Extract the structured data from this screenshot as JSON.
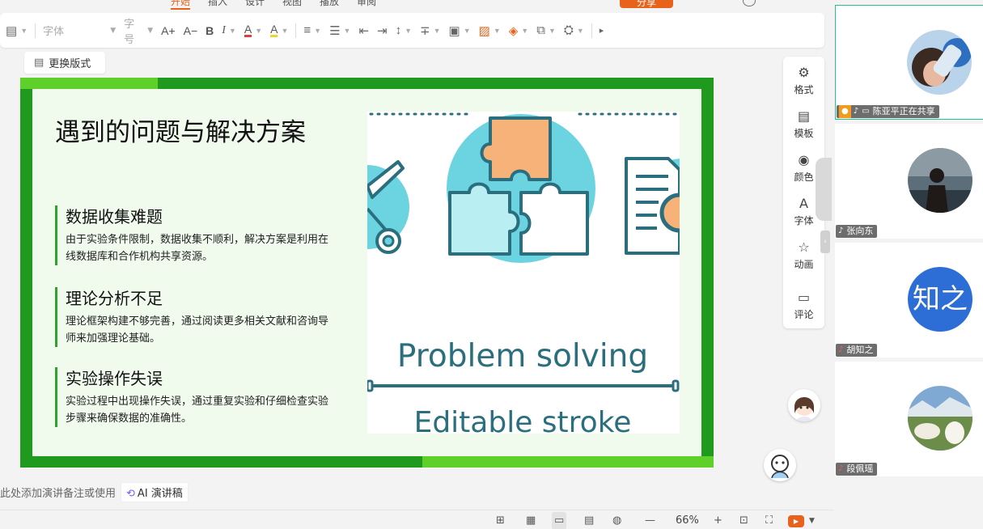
{
  "tabs": {
    "items": [
      "开始",
      "插入",
      "设计",
      "视图",
      "播放",
      "审阅",
      ""
    ]
  },
  "header": {
    "share_label": "分享"
  },
  "toolbar": {
    "font_placeholder": "字体",
    "size_placeholder": "字号",
    "grow_font": "A+",
    "shrink_font": "A−",
    "bold": "B",
    "italic": "I",
    "font_color": "A",
    "highlight": "A",
    "more": "▸"
  },
  "layout_button": {
    "label": "更换版式"
  },
  "slide": {
    "title": "遇到的问题与解决方案",
    "points": [
      {
        "title": "数据收集难题",
        "desc": "由于实验条件限制，数据收集不顺利，解决方案是利用在线数据库和合作机构共享资源。"
      },
      {
        "title": "理论分析不足",
        "desc": "理论框架构建不够完善，通过阅读更多相关文献和咨询导师来加强理论基础。"
      },
      {
        "title": "实验操作失误",
        "desc": "实验过程中出现操作失误，通过重复实验和仔细检查实验步骤来确保数据的准确性。"
      }
    ],
    "illustration": {
      "text1": "Problem solving",
      "text2": "Editable stroke"
    }
  },
  "side_panel": {
    "items": [
      {
        "label": "格式",
        "icon": "gear-icon",
        "glyph": "⚙"
      },
      {
        "label": "模板",
        "icon": "template-icon",
        "glyph": "▤"
      },
      {
        "label": "颜色",
        "icon": "palette-icon",
        "glyph": "◉"
      },
      {
        "label": "字体",
        "icon": "font-icon",
        "glyph": "A"
      },
      {
        "label": "动画",
        "icon": "star-icon",
        "glyph": "☆"
      },
      {
        "label": "评论",
        "icon": "comment-icon",
        "glyph": "▭"
      }
    ]
  },
  "notes": {
    "placeholder": "此处添加演讲备注或使用",
    "ai_label": "AI 演讲稿"
  },
  "statusbar": {
    "zoom": "66%"
  },
  "participants": [
    {
      "name": "陈亚平正在共享",
      "sharing": true,
      "avatar": "photo"
    },
    {
      "name": "张向东",
      "sharing": false,
      "avatar": "photo"
    },
    {
      "name": "胡知之",
      "sharing": false,
      "avatar": "text",
      "avatar_text": "知之"
    },
    {
      "name": "段佩瑶",
      "sharing": false,
      "avatar": "photo"
    }
  ],
  "colors": {
    "accent": "#e8621c",
    "slide_green": "#1f9a1f",
    "slide_light_green": "#5fd02a",
    "teal": "#2b6f7f",
    "active_tile": "#23c38e",
    "avatar_blue": "#2c6ed6"
  }
}
